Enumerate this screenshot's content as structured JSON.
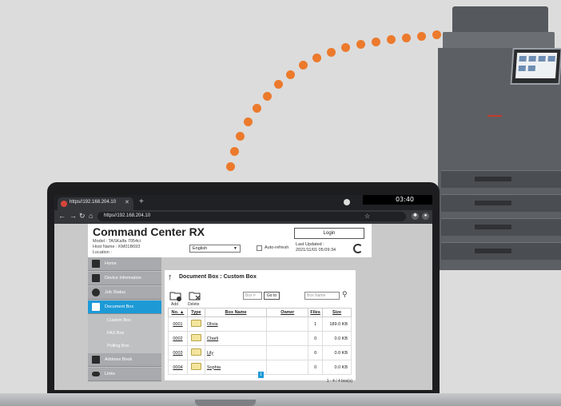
{
  "browser": {
    "tab_title": "https//192.168.204.10",
    "url": "https//192.168.204.10",
    "clock": "03:40"
  },
  "app": {
    "title": "Command Center RX",
    "model": "Model : TASKalfa 7054ci",
    "host": "Host Name : KM01B693",
    "location": "Location :",
    "language": "English",
    "auto_refresh": "Auto-refresh",
    "login": "Login",
    "last_updated_label": "Last Updated :",
    "last_updated_value": "2021/11/01 05:09:34"
  },
  "sidebar": {
    "items": [
      {
        "label": "Home",
        "icon": "home-icon"
      },
      {
        "label": "Device Information",
        "icon": "device-info-icon"
      },
      {
        "label": "Job Status",
        "icon": "job-status-icon"
      },
      {
        "label": "Document Box",
        "icon": "document-box-icon"
      },
      {
        "label": "Address Book",
        "icon": "address-book-icon"
      },
      {
        "label": "Links",
        "icon": "links-icon"
      }
    ],
    "sub_items": [
      "Custom Box",
      "FAX Box",
      "Polling Box"
    ]
  },
  "content": {
    "title": "Document Box : Custom Box",
    "add": "Add",
    "delete": "Delete",
    "box_no_placeholder": "Box #",
    "go": "Go to",
    "box_name_placeholder": "Box Name",
    "columns": [
      "No. ▲",
      "Type",
      "Box Name",
      "Owner",
      "Files",
      "Size"
    ],
    "rows": [
      {
        "no": "0001",
        "name": "Olivia",
        "owner": "",
        "files": "1",
        "size": "189.0 KB"
      },
      {
        "no": "0002",
        "name": "Charli",
        "owner": "",
        "files": "0",
        "size": "0.0 KB"
      },
      {
        "no": "0003",
        "name": "Lily",
        "owner": "",
        "files": "0",
        "size": "0.0 KB"
      },
      {
        "no": "0004",
        "name": "Sophia",
        "owner": "",
        "files": "0",
        "size": "0.0 KB"
      }
    ],
    "page": "1",
    "count": "1 - 4 / 4 box(s)"
  },
  "colors": {
    "accent": "#1d9ad6",
    "dots": "#ec7a2c"
  }
}
